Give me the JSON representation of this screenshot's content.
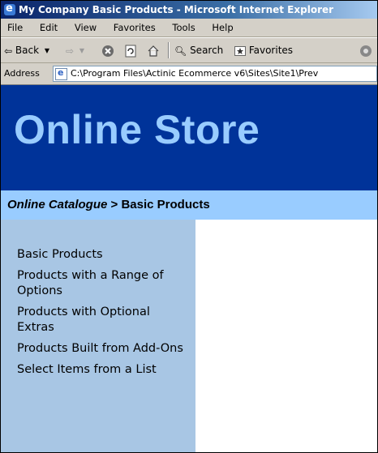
{
  "window": {
    "title": "My Company Basic Products - Microsoft Internet Explorer"
  },
  "menu": [
    "File",
    "Edit",
    "View",
    "Favorites",
    "Tools",
    "Help"
  ],
  "toolbar": {
    "back_label": "Back",
    "search_label": "Search",
    "favorites_label": "Favorites"
  },
  "address": {
    "label": "Address",
    "value": "C:\\Program Files\\Actinic Ecommerce v6\\Sites\\Site1\\Prev"
  },
  "page": {
    "store_title": "Online Store",
    "breadcrumb": {
      "link": "Online Catalogue",
      "separator": ">",
      "current": "Basic Products"
    },
    "sidebar_items": [
      "Basic Products",
      "Products with a Range of Options",
      "Products with Optional Extras",
      "Products Built from Add-Ons",
      "Select Items from a List"
    ]
  },
  "colors": {
    "header_bg": "#003399",
    "header_text": "#99ccff",
    "breadcrumb_bg": "#99ccff",
    "sidebar_bg": "#a8c6e4"
  }
}
